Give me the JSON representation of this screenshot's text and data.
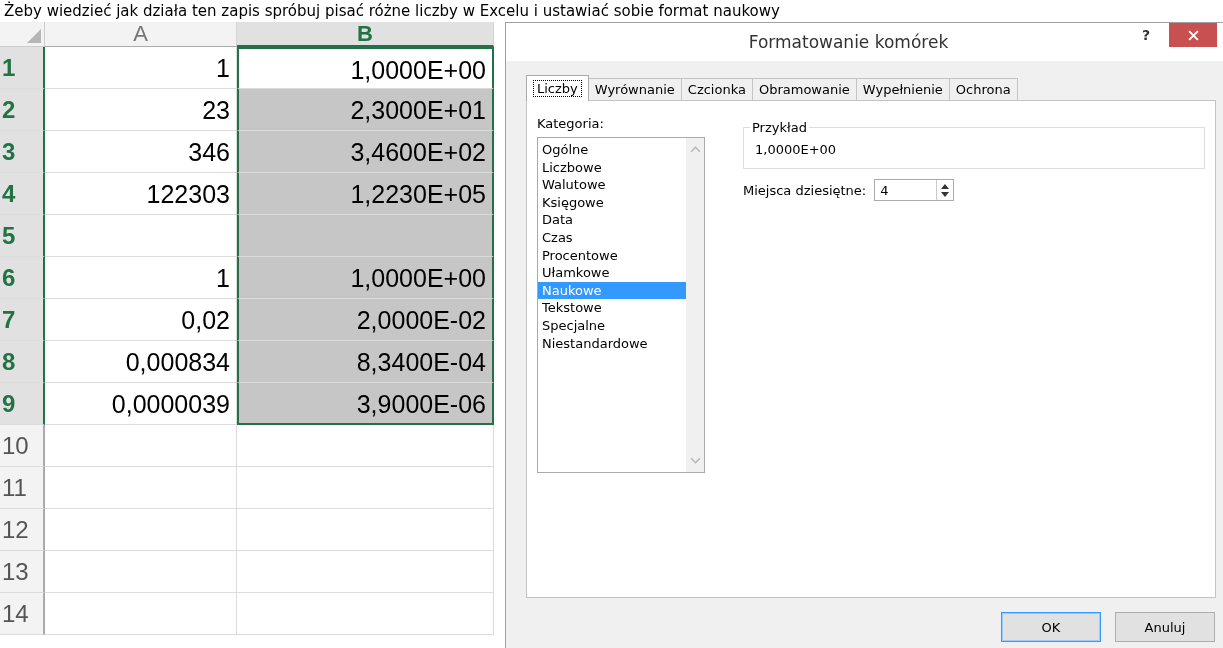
{
  "caption": "Żeby wiedzieć jak działa ten zapis spróbuj pisać różne liczby w Excelu i ustawiać sobie format naukowy",
  "sheet": {
    "columns": [
      {
        "label": "A",
        "selected": false
      },
      {
        "label": "B",
        "selected": true
      }
    ],
    "rows": [
      {
        "header": "1",
        "selected": true,
        "active": true,
        "a": "1",
        "b": "1,0000E+00"
      },
      {
        "header": "2",
        "selected": true,
        "active": false,
        "a": "23",
        "b": "2,3000E+01"
      },
      {
        "header": "3",
        "selected": true,
        "active": false,
        "a": "346",
        "b": "3,4600E+02"
      },
      {
        "header": "4",
        "selected": true,
        "active": false,
        "a": "122303",
        "b": "1,2230E+05"
      },
      {
        "header": "5",
        "selected": true,
        "active": false
      },
      {
        "header": "6",
        "selected": true,
        "active": false,
        "a": "1",
        "b": "1,0000E+00"
      },
      {
        "header": "7",
        "selected": true,
        "active": false,
        "a": "0,02",
        "b": "2,0000E-02"
      },
      {
        "header": "8",
        "selected": true,
        "active": false,
        "a": "0,000834",
        "b": "8,3400E-04"
      },
      {
        "header": "9",
        "selected": true,
        "active": false,
        "a": "0,0000039",
        "b": "3,9000E-06"
      },
      {
        "header": "10",
        "selected": false
      },
      {
        "header": "11",
        "selected": false
      },
      {
        "header": "12",
        "selected": false
      },
      {
        "header": "13",
        "selected": false
      },
      {
        "header": "14",
        "selected": false
      }
    ]
  },
  "dialog": {
    "title": "Formatowanie komórek",
    "help": "?",
    "tabs": [
      {
        "label": "Liczby",
        "selected": true
      },
      {
        "label": "Wyrównanie",
        "selected": false
      },
      {
        "label": "Czcionka",
        "selected": false
      },
      {
        "label": "Obramowanie",
        "selected": false
      },
      {
        "label": "Wypełnienie",
        "selected": false
      },
      {
        "label": "Ochrona",
        "selected": false
      }
    ],
    "category_label": "Kategoria:",
    "categories": [
      {
        "label": "Ogólne",
        "selected": false
      },
      {
        "label": "Liczbowe",
        "selected": false
      },
      {
        "label": "Walutowe",
        "selected": false
      },
      {
        "label": "Księgowe",
        "selected": false
      },
      {
        "label": "Data",
        "selected": false
      },
      {
        "label": "Czas",
        "selected": false
      },
      {
        "label": "Procentowe",
        "selected": false
      },
      {
        "label": "Ułamkowe",
        "selected": false
      },
      {
        "label": "Naukowe",
        "selected": true
      },
      {
        "label": "Tekstowe",
        "selected": false
      },
      {
        "label": "Specjalne",
        "selected": false
      },
      {
        "label": "Niestandardowe",
        "selected": false
      }
    ],
    "sample": {
      "label": "Przykład",
      "value": "1,0000E+00"
    },
    "decimals": {
      "label": "Miejsca dziesiętne:",
      "value": "4"
    },
    "buttons": [
      {
        "label": "OK",
        "default": true
      },
      {
        "label": "Anuluj",
        "default": false
      }
    ]
  }
}
